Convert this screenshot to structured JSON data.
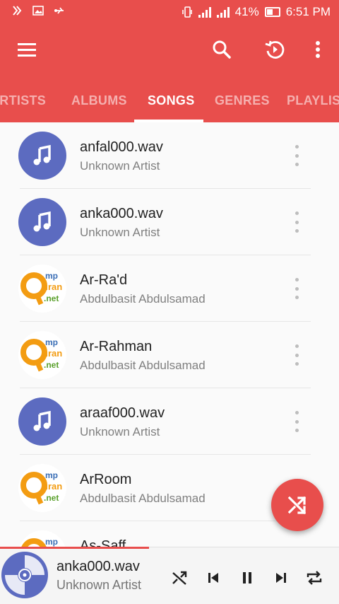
{
  "status_bar": {
    "signal_percent": "41%",
    "time": "6:51 PM",
    "battery_level": 0.41,
    "icons_left": [
      "notification-icon",
      "image-icon",
      "usb-icon"
    ],
    "icons_right": [
      "vibrate-icon",
      "signal-icon",
      "signal-icon",
      "battery-charging-icon"
    ]
  },
  "toolbar": {
    "icons": [
      "menu-icon",
      "search-icon",
      "history-icon",
      "more-vert-icon"
    ]
  },
  "tabs": [
    {
      "label": "ARTISTS",
      "active": false
    },
    {
      "label": "ALBUMS",
      "active": false
    },
    {
      "label": "SONGS",
      "active": true
    },
    {
      "label": "GENRES",
      "active": false
    },
    {
      "label": "PLAYLISTS",
      "active": false
    }
  ],
  "songs": [
    {
      "title": "anfal000.wav",
      "artist": "Unknown Artist",
      "art": "music-note-icon"
    },
    {
      "title": "anka000.wav",
      "artist": "Unknown Artist",
      "art": "music-note-icon"
    },
    {
      "title": "Ar-Ra'd",
      "artist": "Abdulbasit Abdulsamad",
      "art": "mp3quran-logo"
    },
    {
      "title": "Ar-Rahman",
      "artist": "Abdulbasit Abdulsamad",
      "art": "mp3quran-logo"
    },
    {
      "title": "araaf000.wav",
      "artist": "Unknown Artist",
      "art": "music-note-icon"
    },
    {
      "title": "ArRoom",
      "artist": "Abdulbasit Abdulsamad",
      "art": "mp3quran-logo"
    },
    {
      "title": "As-Saff",
      "artist": "",
      "art": "mp3quran-logo"
    }
  ],
  "logo": {
    "line1": "mp",
    "line2": "uran",
    "line3": ".net"
  },
  "fab": {
    "icon": "shuffle-icon"
  },
  "player": {
    "title": "anka000.wav",
    "artist": "Unknown Artist",
    "progress": 0.44,
    "controls": [
      "shuffle-icon",
      "skip-previous-icon",
      "pause-icon",
      "skip-next-icon",
      "repeat-icon"
    ]
  },
  "colors": {
    "primary": "#e84e4c",
    "avatar": "#5c6bc0",
    "logo_orange": "#f39c12",
    "logo_green": "#5aa02c"
  }
}
